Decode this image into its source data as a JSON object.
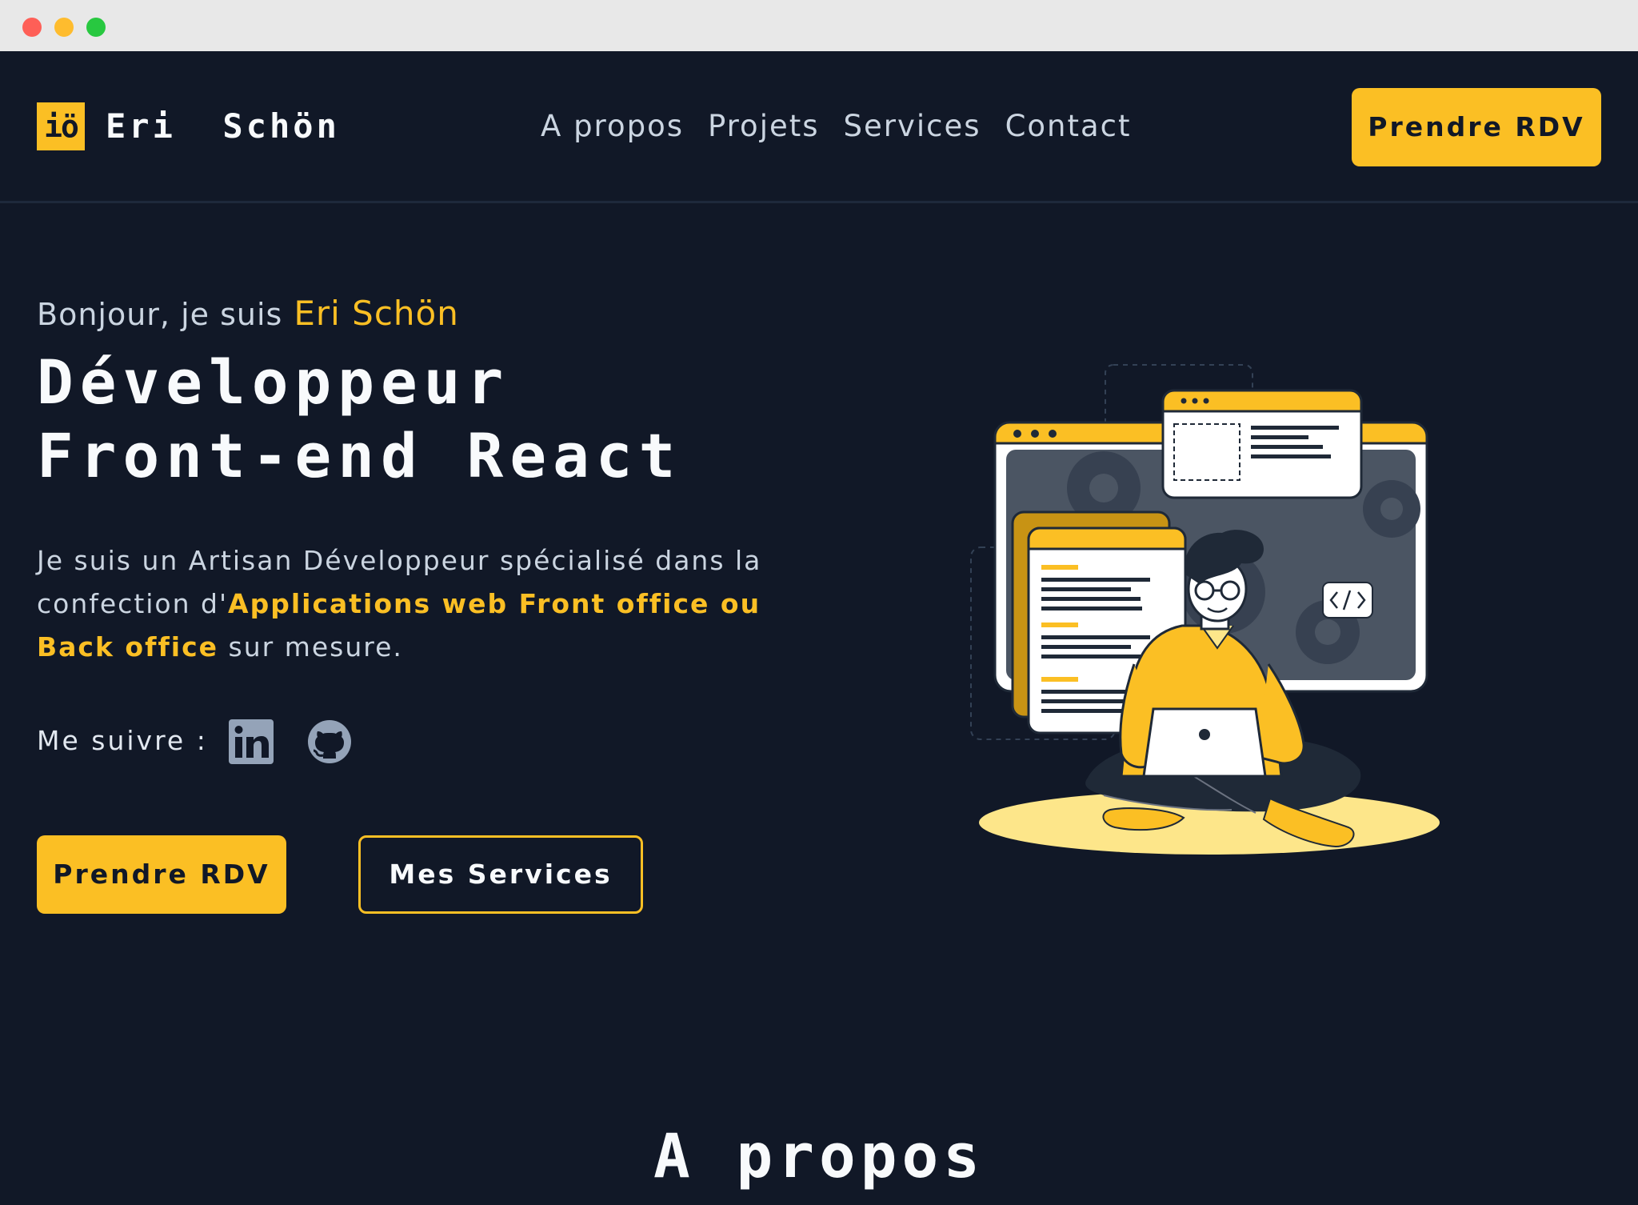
{
  "brand": {
    "logo_mark": "iö",
    "name": "Eri  Schön"
  },
  "nav": {
    "links": [
      "A propos",
      "Projets",
      "Services",
      "Contact"
    ],
    "cta_label": "Prendre RDV"
  },
  "hero": {
    "greeting": "Bonjour, je suis",
    "greeting_name": "Eri Schön",
    "headline_line1": "Développeur",
    "headline_line2": "Front-end React",
    "intro_prefix": "Je suis un Artisan Développeur spécialisé dans la confection d'",
    "intro_highlight": "Applications web Front office ou Back office",
    "intro_suffix": " sur mesure.",
    "follow_label": "Me suivre :",
    "social_icons": [
      "linkedin-icon",
      "github-icon"
    ],
    "primary_cta": "Prendre RDV",
    "secondary_cta": "Mes Services"
  },
  "about": {
    "title": "A propos"
  },
  "colors": {
    "background": "#111827",
    "accent": "#fbbf24",
    "text": "#f8fafc",
    "muted": "#cbd5e1"
  }
}
